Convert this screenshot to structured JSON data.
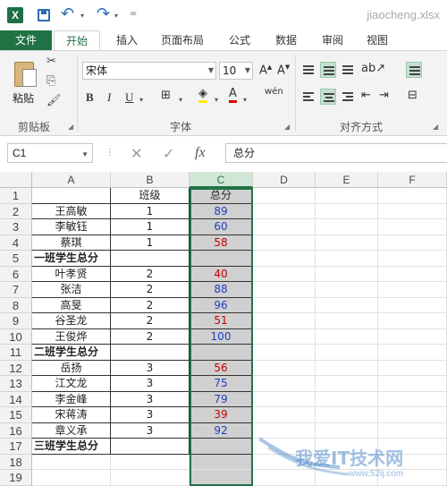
{
  "titlebar": {
    "logo": "X",
    "filename": "jiaocheng.xlsx"
  },
  "tabs": [
    "文件",
    "开始",
    "插入",
    "页面布局",
    "公式",
    "数据",
    "审阅",
    "视图"
  ],
  "ribbon": {
    "paste_label": "粘贴",
    "font_name": "宋体",
    "font_size": "10",
    "groups": {
      "clipboard": "剪贴板",
      "font": "字体",
      "alignment": "对齐方式"
    },
    "bold": "B",
    "italic": "I",
    "underline": "U",
    "phonetic": "wén"
  },
  "formula_bar": {
    "name_box": "C1",
    "formula": "总分"
  },
  "grid": {
    "columns": [
      "A",
      "B",
      "C",
      "D",
      "E",
      "F"
    ],
    "rows": [
      {
        "n": "1",
        "a": "",
        "b": "班级",
        "c": "总分",
        "c_color": "normal"
      },
      {
        "n": "2",
        "a": "王高敏",
        "b": "1",
        "c": "89",
        "c_color": "blue"
      },
      {
        "n": "3",
        "a": "李敏钰",
        "b": "1",
        "c": "60",
        "c_color": "blue"
      },
      {
        "n": "4",
        "a": "蔡琪",
        "b": "1",
        "c": "58",
        "c_color": "red"
      },
      {
        "n": "5",
        "a": "一班学生总分",
        "b": "",
        "c": "",
        "c_color": "normal",
        "bold": true
      },
      {
        "n": "6",
        "a": "叶孝贤",
        "b": "2",
        "c": "40",
        "c_color": "red"
      },
      {
        "n": "7",
        "a": "张洁",
        "b": "2",
        "c": "88",
        "c_color": "blue"
      },
      {
        "n": "8",
        "a": "高旻",
        "b": "2",
        "c": "96",
        "c_color": "blue"
      },
      {
        "n": "9",
        "a": "谷圣龙",
        "b": "2",
        "c": "51",
        "c_color": "red"
      },
      {
        "n": "10",
        "a": "王俊烨",
        "b": "2",
        "c": "100",
        "c_color": "blue"
      },
      {
        "n": "11",
        "a": "二班学生总分",
        "b": "",
        "c": "",
        "c_color": "normal",
        "bold": true
      },
      {
        "n": "12",
        "a": "岳扬",
        "b": "3",
        "c": "56",
        "c_color": "red"
      },
      {
        "n": "13",
        "a": "江文龙",
        "b": "3",
        "c": "75",
        "c_color": "blue"
      },
      {
        "n": "14",
        "a": "李金峰",
        "b": "3",
        "c": "79",
        "c_color": "blue"
      },
      {
        "n": "15",
        "a": "宋蒋涛",
        "b": "3",
        "c": "39",
        "c_color": "red"
      },
      {
        "n": "16",
        "a": "章义承",
        "b": "3",
        "c": "92",
        "c_color": "blue"
      },
      {
        "n": "17",
        "a": "三班学生总分",
        "b": "",
        "c": "",
        "c_color": "normal",
        "bold": true
      },
      {
        "n": "18",
        "a": "",
        "b": "",
        "c": "",
        "c_color": "normal"
      },
      {
        "n": "19",
        "a": "",
        "b": "",
        "c": "",
        "c_color": "normal"
      }
    ]
  },
  "watermark": {
    "text": "我爱IT技术网",
    "url": "www.52ij.com"
  },
  "colors": {
    "excel_green": "#217346",
    "red_value": "#c00000",
    "blue_value": "#1f3fbf",
    "selected_fill": "#d0d0d0"
  }
}
